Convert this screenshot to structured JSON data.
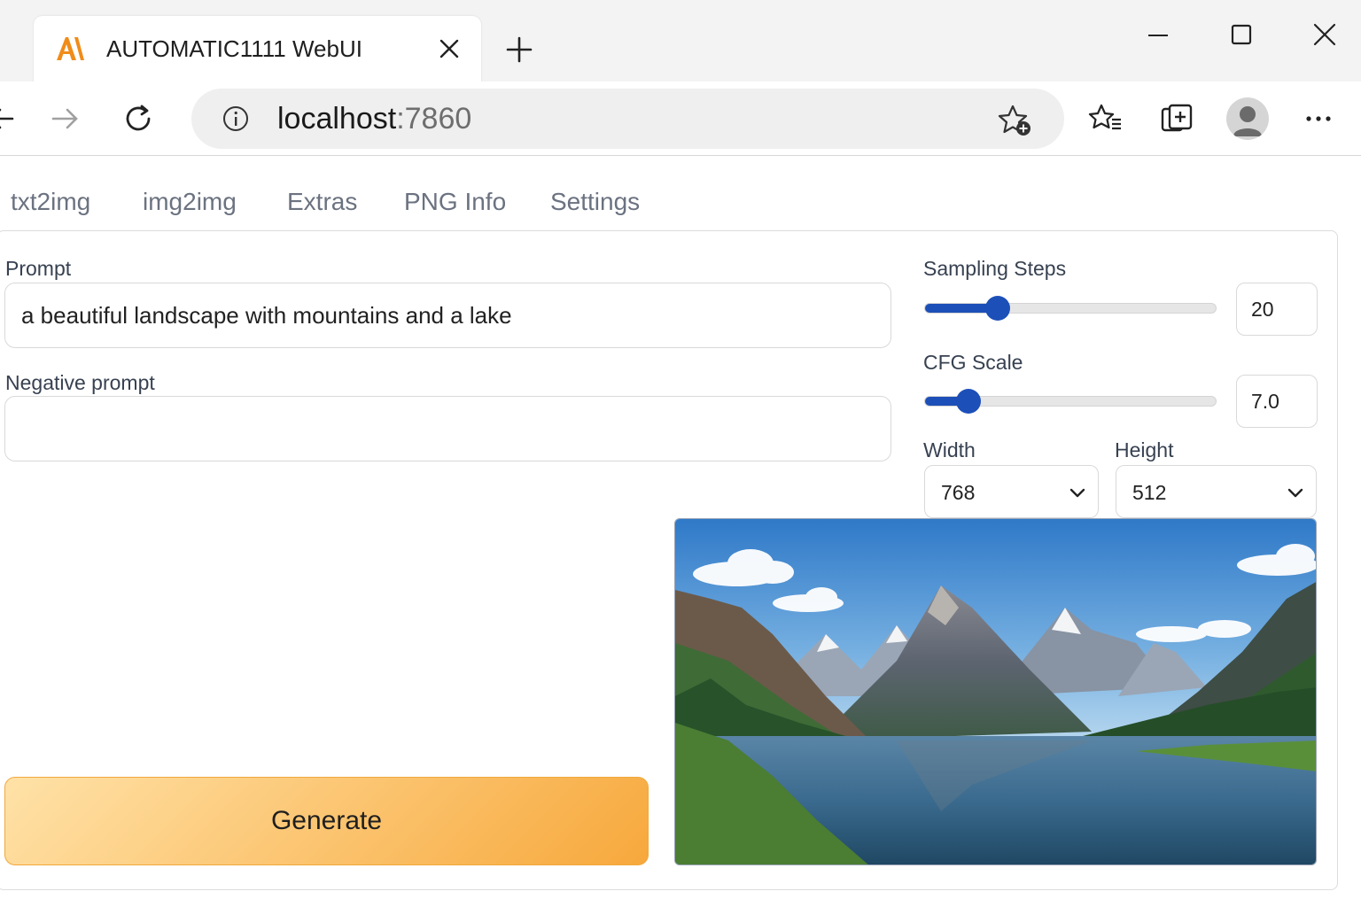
{
  "browser": {
    "tab_title": "AUTOMATIC1111 WebUI",
    "logo_text": "A\\",
    "address_host": "localhost",
    "address_port": ":7860",
    "accent_color": "#f08c1a"
  },
  "webui": {
    "tabs": [
      {
        "label": "txt2img"
      },
      {
        "label": "img2img"
      },
      {
        "label": "Extras"
      },
      {
        "label": "PNG Info"
      },
      {
        "label": "Settings"
      }
    ],
    "prompt": {
      "label": "Prompt",
      "value": "a beautiful landscape with mountains and a lake"
    },
    "negative_prompt": {
      "label": "Negative prompt",
      "value": ""
    },
    "sampling_steps": {
      "label": "Sampling Steps",
      "value": "20",
      "fraction": 0.25
    },
    "cfg_scale": {
      "label": "CFG Scale",
      "value": "7.0",
      "fraction": 0.15
    },
    "width": {
      "label": "Width",
      "value": "768"
    },
    "height": {
      "label": "Height",
      "value": "512"
    },
    "generate_label": "Generate",
    "slider_color": "#1d4fb8"
  }
}
